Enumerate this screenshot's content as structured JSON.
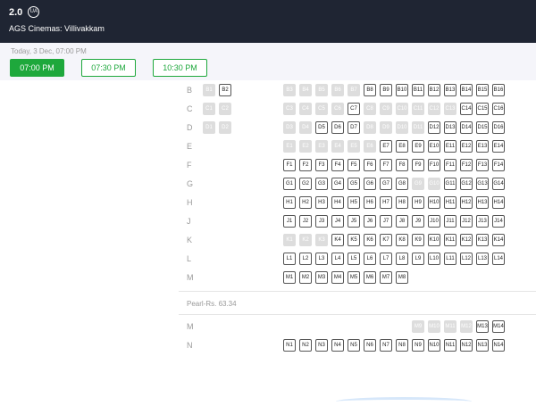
{
  "header": {
    "movie_title": "2.0",
    "certificate": "UA",
    "venue": "AGS Cinemas: Villivakkam"
  },
  "showtimes": {
    "date_label": "Today, 3 Dec, 07:00 PM",
    "times": [
      {
        "label": "07:00 PM",
        "active": true
      },
      {
        "label": "07:30 PM",
        "active": false
      },
      {
        "label": "10:30 PM",
        "active": false
      }
    ]
  },
  "seat_map": {
    "rows": [
      {
        "letter": "B",
        "seats": [
          [
            1,
            false
          ],
          [
            2,
            true
          ],
          [
            3,
            false
          ],
          [
            4,
            false
          ],
          [
            5,
            false
          ],
          [
            6,
            false
          ],
          [
            7,
            false
          ],
          [
            8,
            true
          ],
          [
            9,
            true
          ],
          [
            10,
            true
          ],
          [
            11,
            true
          ],
          [
            12,
            true
          ],
          [
            13,
            true
          ],
          [
            14,
            true
          ],
          [
            15,
            true
          ],
          [
            16,
            true
          ]
        ]
      },
      {
        "letter": "C",
        "seats": [
          [
            1,
            false
          ],
          [
            2,
            false
          ],
          [
            3,
            false
          ],
          [
            4,
            false
          ],
          [
            5,
            false
          ],
          [
            6,
            false
          ],
          [
            7,
            true
          ],
          [
            8,
            false
          ],
          [
            9,
            false
          ],
          [
            10,
            false
          ],
          [
            11,
            false
          ],
          [
            12,
            false
          ],
          [
            13,
            false
          ],
          [
            14,
            true
          ],
          [
            15,
            true
          ],
          [
            16,
            true
          ]
        ]
      },
      {
        "letter": "D",
        "seats": [
          [
            1,
            false
          ],
          [
            2,
            false
          ],
          [
            3,
            false
          ],
          [
            4,
            false
          ],
          [
            5,
            true
          ],
          [
            6,
            true
          ],
          [
            7,
            true
          ],
          [
            8,
            false
          ],
          [
            9,
            false
          ],
          [
            10,
            false
          ],
          [
            11,
            false
          ],
          [
            12,
            true
          ],
          [
            13,
            true
          ],
          [
            14,
            true
          ],
          [
            15,
            true
          ],
          [
            16,
            true
          ]
        ]
      },
      {
        "letter": "E",
        "seats": [
          [
            1,
            false
          ],
          [
            2,
            false
          ],
          [
            3,
            false
          ],
          [
            4,
            false
          ],
          [
            5,
            false
          ],
          [
            6,
            false
          ],
          [
            7,
            true
          ],
          [
            8,
            true
          ],
          [
            9,
            true
          ],
          [
            10,
            true
          ],
          [
            11,
            true
          ],
          [
            12,
            true
          ],
          [
            13,
            true
          ],
          [
            14,
            true
          ]
        ]
      },
      {
        "letter": "F",
        "seats": [
          [
            1,
            true
          ],
          [
            2,
            true
          ],
          [
            3,
            true
          ],
          [
            4,
            true
          ],
          [
            5,
            true
          ],
          [
            6,
            true
          ],
          [
            7,
            true
          ],
          [
            8,
            true
          ],
          [
            9,
            true
          ],
          [
            10,
            true
          ],
          [
            11,
            true
          ],
          [
            12,
            true
          ],
          [
            13,
            true
          ],
          [
            14,
            true
          ]
        ]
      },
      {
        "letter": "G",
        "seats": [
          [
            1,
            true
          ],
          [
            2,
            true
          ],
          [
            3,
            true
          ],
          [
            4,
            true
          ],
          [
            5,
            true
          ],
          [
            6,
            true
          ],
          [
            7,
            true
          ],
          [
            8,
            true
          ],
          [
            9,
            false
          ],
          [
            10,
            false
          ],
          [
            11,
            true
          ],
          [
            12,
            true
          ],
          [
            13,
            true
          ],
          [
            14,
            true
          ]
        ]
      },
      {
        "letter": "H",
        "seats": [
          [
            1,
            true
          ],
          [
            2,
            true
          ],
          [
            3,
            true
          ],
          [
            4,
            true
          ],
          [
            5,
            true
          ],
          [
            6,
            true
          ],
          [
            7,
            true
          ],
          [
            8,
            true
          ],
          [
            9,
            true
          ],
          [
            10,
            true
          ],
          [
            11,
            true
          ],
          [
            12,
            true
          ],
          [
            13,
            true
          ],
          [
            14,
            true
          ]
        ]
      },
      {
        "letter": "J",
        "seats": [
          [
            1,
            true
          ],
          [
            2,
            true
          ],
          [
            3,
            true
          ],
          [
            4,
            true
          ],
          [
            5,
            true
          ],
          [
            6,
            true
          ],
          [
            7,
            true
          ],
          [
            8,
            true
          ],
          [
            9,
            true
          ],
          [
            10,
            true
          ],
          [
            11,
            true
          ],
          [
            12,
            true
          ],
          [
            13,
            true
          ],
          [
            14,
            true
          ]
        ]
      },
      {
        "letter": "K",
        "seats": [
          [
            1,
            false
          ],
          [
            2,
            false
          ],
          [
            3,
            false
          ],
          [
            4,
            true
          ],
          [
            5,
            true
          ],
          [
            6,
            true
          ],
          [
            7,
            true
          ],
          [
            8,
            true
          ],
          [
            9,
            true
          ],
          [
            10,
            true
          ],
          [
            11,
            true
          ],
          [
            12,
            true
          ],
          [
            13,
            true
          ],
          [
            14,
            true
          ]
        ]
      },
      {
        "letter": "L",
        "seats": [
          [
            1,
            true
          ],
          [
            2,
            true
          ],
          [
            3,
            true
          ],
          [
            4,
            true
          ],
          [
            5,
            true
          ],
          [
            6,
            true
          ],
          [
            7,
            true
          ],
          [
            8,
            true
          ],
          [
            9,
            true
          ],
          [
            10,
            true
          ],
          [
            11,
            true
          ],
          [
            12,
            true
          ],
          [
            13,
            true
          ],
          [
            14,
            true
          ]
        ]
      },
      {
        "letter": "M",
        "seats": [
          [
            1,
            true
          ],
          [
            2,
            true
          ],
          [
            3,
            true
          ],
          [
            4,
            true
          ],
          [
            5,
            true
          ],
          [
            6,
            true
          ],
          [
            7,
            true
          ],
          [
            8,
            true
          ]
        ]
      }
    ],
    "pearl_section_label": "Pearl-Rs. 63.34",
    "pearl_rows": [
      {
        "letter": "M",
        "seats": [
          [
            9,
            false
          ],
          [
            10,
            false
          ],
          [
            11,
            false
          ],
          [
            12,
            false
          ],
          [
            13,
            true
          ],
          [
            14,
            true
          ]
        ]
      },
      {
        "letter": "N",
        "seats": [
          [
            1,
            true
          ],
          [
            2,
            true
          ],
          [
            3,
            true
          ],
          [
            4,
            true
          ],
          [
            5,
            true
          ],
          [
            6,
            true
          ],
          [
            7,
            true
          ],
          [
            8,
            true
          ],
          [
            9,
            true
          ],
          [
            10,
            true
          ],
          [
            11,
            true
          ],
          [
            12,
            true
          ],
          [
            13,
            true
          ],
          [
            14,
            true
          ]
        ]
      }
    ]
  },
  "colors": {
    "header_bg": "#1f2533",
    "accent_green": "#1ea83c",
    "sold_seat": "#dddddd"
  }
}
